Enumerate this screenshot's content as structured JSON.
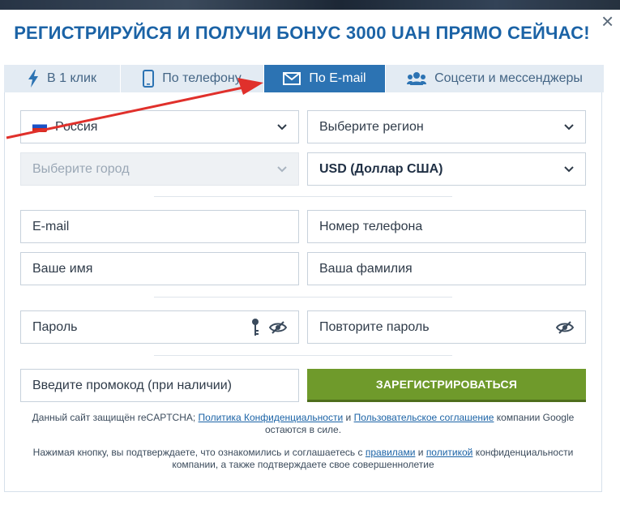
{
  "modal": {
    "title": "РЕГИСТРИРУЙСЯ И ПОЛУЧИ БОНУС 3000 UAH ПРЯМО СЕЙЧАС!",
    "close_symbol": "×"
  },
  "tabs": [
    {
      "label": "В 1 клик",
      "icon": "lightning-icon",
      "active": false
    },
    {
      "label": "По телефону",
      "icon": "phone-icon",
      "active": false
    },
    {
      "label": "По E-mail",
      "icon": "envelope-icon",
      "active": true
    },
    {
      "label": "Соцсети и мессенджеры",
      "icon": "people-icon",
      "active": false
    }
  ],
  "form": {
    "country": "Россия",
    "region_placeholder": "Выберите регион",
    "city_placeholder": "Выберите город",
    "currency": "USD (Доллар США)",
    "email_placeholder": "E-mail",
    "phone_placeholder": "Номер телефона",
    "name_placeholder": "Ваше имя",
    "surname_placeholder": "Ваша фамилия",
    "password_placeholder": "Пароль",
    "repeat_password_placeholder": "Повторите пароль",
    "promo_placeholder": "Введите промокод (при наличии)",
    "register_label": "ЗАРЕГИСТРИРОВАТЬСЯ"
  },
  "footer": {
    "recaptcha_pre": "Данный сайт защищён reCAPTCHA;",
    "privacy_link": "Политика Конфиденциальности",
    "and": "и",
    "terms_link": "Пользовательское соглашение",
    "recaptcha_post": "компании Google остаются в силе.",
    "consent_pre": "Нажимая кнопку, вы подтверждаете, что ознакомились и соглашаетесь с",
    "rules_link": "правилами",
    "and2": "и",
    "policy_link": "политикой",
    "consent_post": "конфиденциальности компании, а также подтверждаете свое совершеннолетие"
  },
  "colors": {
    "accent": "#2c73b3",
    "title": "#1b63a6",
    "button": "#6f9a2b",
    "arrow": "#e0302b"
  }
}
